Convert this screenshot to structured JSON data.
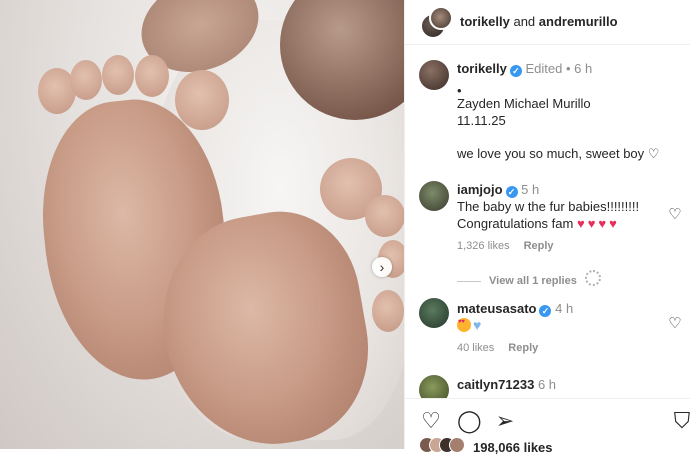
{
  "post": {
    "image_alt_icon": "next-arrow-icon",
    "next_glyph": "›"
  },
  "header": {
    "user1": "torikelly",
    "and_text": " and ",
    "user2": "andremurillo"
  },
  "caption": {
    "username": "torikelly",
    "verified_glyph": "✓",
    "edited": "Edited",
    "dot": "•",
    "time": "6 h",
    "line1": "•",
    "line2": "Zayden Michael Murillo",
    "line3": "11.11.25",
    "line4": "we love you so much, sweet boy ♡"
  },
  "comments": [
    {
      "username": "iamjojo",
      "time": "5 h",
      "text1": "The baby w the fur babies!!!!!!!!!",
      "text2": "Congratulations fam",
      "emojis": "♥♥♥♥",
      "likes": "1,326 likes",
      "reply": "Reply",
      "view_replies": "View all 1 replies"
    },
    {
      "username": "mateusasato",
      "time": "4 h",
      "blue_heart": "♥",
      "likes": "40 likes",
      "reply": "Reply"
    },
    {
      "username": "caitlyn71233",
      "time": "6 h"
    }
  ],
  "footer": {
    "likes_count": "198,066 likes",
    "heart_glyph": "♡",
    "comment_glyph": "◯",
    "share_glyph": "➢",
    "save_glyph": "⛉"
  },
  "colors": {
    "verified": "#3897f0",
    "meta": "#8e8e8e",
    "heart_red": "#e5305a"
  }
}
